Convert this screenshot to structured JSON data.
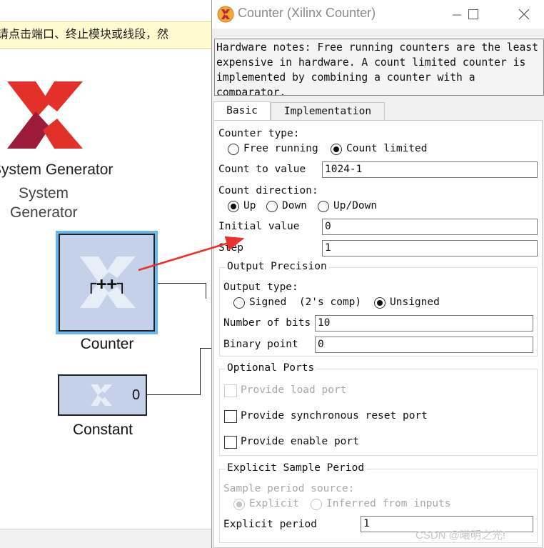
{
  "canvas": {
    "hint_text": "请点击端口、终止模块或线段，然",
    "logo_label_1": "System Generator",
    "logo_label_2_line1": "System",
    "logo_label_2_line2": "Generator",
    "counter_block": {
      "glyph": "┌++┐",
      "label": "Counter"
    },
    "constant_block": {
      "value": "0",
      "label": "Constant"
    }
  },
  "dialog": {
    "title": "Counter (Xilinx Counter)",
    "notes": "Hardware notes: Free running counters are the least\nexpensive in hardware. A count limited counter is\nimplemented by combining a counter with a\ncomparator.",
    "tabs": [
      {
        "label": "Basic"
      },
      {
        "label": "Implementation"
      }
    ],
    "counter_type": {
      "label": "Counter type:",
      "options": [
        "Free running",
        "Count limited"
      ],
      "selected": "Count limited"
    },
    "count_to": {
      "label": "Count to value",
      "value": "1024-1"
    },
    "count_direction": {
      "label": "Count direction:",
      "options": [
        "Up",
        "Down",
        "Up/Down"
      ],
      "selected": "Up"
    },
    "initial_value": {
      "label": "Initial value",
      "value": "0"
    },
    "step": {
      "label": "Step",
      "value": "1"
    },
    "output_precision": {
      "title": "Output Precision",
      "output_type_label": "Output type:",
      "options": [
        "Signed  (2's comp)",
        "Unsigned"
      ],
      "selected": "Unsigned",
      "bits_label": "Number of bits",
      "bits_value": "10",
      "binary_point_label": "Binary point",
      "binary_point_value": "0"
    },
    "optional_ports": {
      "title": "Optional Ports",
      "load_port": "Provide load port",
      "reset_port": "Provide synchronous reset port",
      "enable_port": "Provide enable port"
    },
    "sample_period": {
      "title": "Explicit Sample Period",
      "source_label": "Sample period source:",
      "options": [
        "Explicit",
        "Inferred from inputs"
      ],
      "selected": "Explicit",
      "period_label": "Explicit period",
      "period_value": "1"
    }
  },
  "watermark": "CSDN @曦明之光!",
  "colors": {
    "block_fill": "#c5d1e8",
    "selection": "#6ab6ef",
    "annotation_arrow": "#e8322b",
    "xilinx_red": "#e3312a"
  }
}
